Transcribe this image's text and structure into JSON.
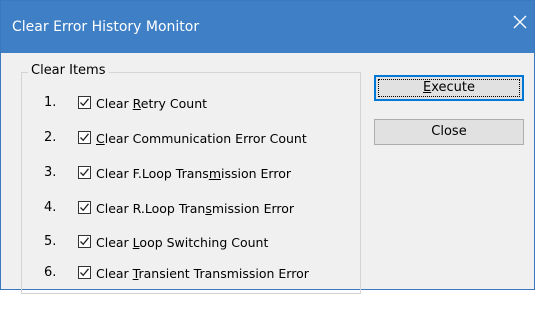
{
  "window": {
    "title": "Clear Error History Monitor",
    "accent_color": "#3f7fc6"
  },
  "group": {
    "legend": "Clear Items",
    "items": [
      {
        "num": "1.",
        "pre": "Clear ",
        "key": "R",
        "post": "etry Count",
        "checked": true
      },
      {
        "num": "2.",
        "pre": "",
        "key": "C",
        "post": "lear Communication Error Count",
        "checked": true
      },
      {
        "num": "3.",
        "pre": "Clear F.Loop Trans",
        "key": "m",
        "post": "ission Error",
        "checked": true
      },
      {
        "num": "4.",
        "pre": "Clear R.Loop Tran",
        "key": "s",
        "post": "mission Error",
        "checked": true
      },
      {
        "num": "5.",
        "pre": "Clear ",
        "key": "L",
        "post": "oop Switching Count",
        "checked": true
      },
      {
        "num": "6.",
        "pre": "Clear ",
        "key": "T",
        "post": "ransient Transmission Error",
        "checked": true
      }
    ]
  },
  "buttons": {
    "execute_key": "E",
    "execute_rest": "xecute",
    "close": "Close"
  },
  "icons": {
    "close": "close-icon",
    "check": "checkmark-icon"
  }
}
